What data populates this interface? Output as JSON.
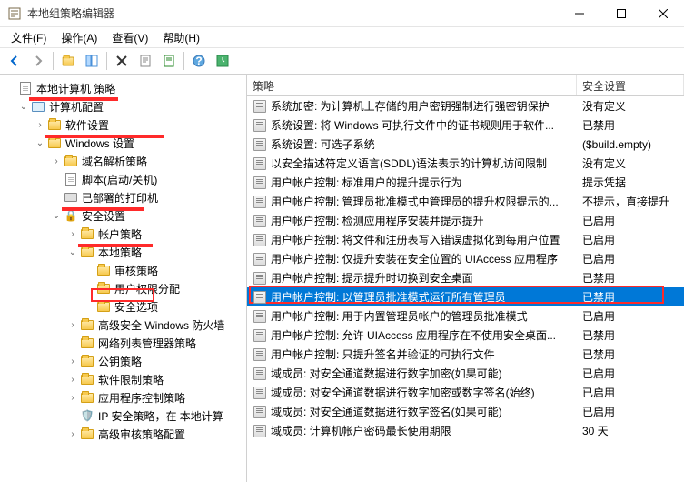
{
  "window": {
    "title": "本地组策略编辑器"
  },
  "menu": {
    "file": "文件(F)",
    "action": "操作(A)",
    "view": "查看(V)",
    "help": "帮助(H)"
  },
  "tree": {
    "root": "本地计算机 策略",
    "computer_config": "计算机配置",
    "software_settings": "软件设置",
    "windows_settings": "Windows 设置",
    "dns_policy": "域名解析策略",
    "scripts": "脚本(启动/关机)",
    "deployed_printers": "已部署的打印机",
    "security_settings": "安全设置",
    "account_policy": "帐户策略",
    "local_policy": "本地策略",
    "audit_policy": "审核策略",
    "user_rights": "用户权限分配",
    "security_options": "安全选项",
    "adv_firewall": "高级安全 Windows 防火墙",
    "netlist_mgr": "网络列表管理器策略",
    "pubkey_policy": "公钥策略",
    "software_restrict": "软件限制策略",
    "app_control": "应用程序控制策略",
    "ip_sec": "IP 安全策略，在 本地计算",
    "adv_audit": "高级审核策略配置"
  },
  "list": {
    "header_policy": "策略",
    "header_setting": "安全设置",
    "rows": [
      {
        "policy": "系统加密: 为计算机上存储的用户密钥强制进行强密钥保护",
        "setting": "没有定义"
      },
      {
        "policy": "系统设置: 将 Windows 可执行文件中的证书规则用于软件...",
        "setting": "已禁用"
      },
      {
        "policy": "系统设置: 可选子系统",
        "setting": "($build.empty)"
      },
      {
        "policy": "以安全描述符定义语言(SDDL)语法表示的计算机访问限制",
        "setting": "没有定义"
      },
      {
        "policy": "用户帐户控制: 标准用户的提升提示行为",
        "setting": "提示凭据"
      },
      {
        "policy": "用户帐户控制: 管理员批准模式中管理员的提升权限提示的...",
        "setting": "不提示，直接提升"
      },
      {
        "policy": "用户帐户控制: 检测应用程序安装并提示提升",
        "setting": "已启用"
      },
      {
        "policy": "用户帐户控制: 将文件和注册表写入错误虚拟化到每用户位置",
        "setting": "已启用"
      },
      {
        "policy": "用户帐户控制: 仅提升安装在安全位置的 UIAccess 应用程序",
        "setting": "已启用"
      },
      {
        "policy": "用户帐户控制: 提示提升时切换到安全桌面",
        "setting": "已禁用"
      },
      {
        "policy": "用户帐户控制: 以管理员批准模式运行所有管理员",
        "setting": "已禁用",
        "selected": true
      },
      {
        "policy": "用户帐户控制: 用于内置管理员帐户的管理员批准模式",
        "setting": "已启用"
      },
      {
        "policy": "用户帐户控制: 允许 UIAccess 应用程序在不使用安全桌面...",
        "setting": "已禁用"
      },
      {
        "policy": "用户帐户控制: 只提升签名并验证的可执行文件",
        "setting": "已禁用"
      },
      {
        "policy": "域成员: 对安全通道数据进行数字加密(如果可能)",
        "setting": "已启用"
      },
      {
        "policy": "域成员: 对安全通道数据进行数字加密或数字签名(始终)",
        "setting": "已启用"
      },
      {
        "policy": "域成员: 对安全通道数据进行数字签名(如果可能)",
        "setting": "已启用"
      },
      {
        "policy": "域成员: 计算机帐户密码最长使用期限",
        "setting": "30 天"
      }
    ]
  }
}
